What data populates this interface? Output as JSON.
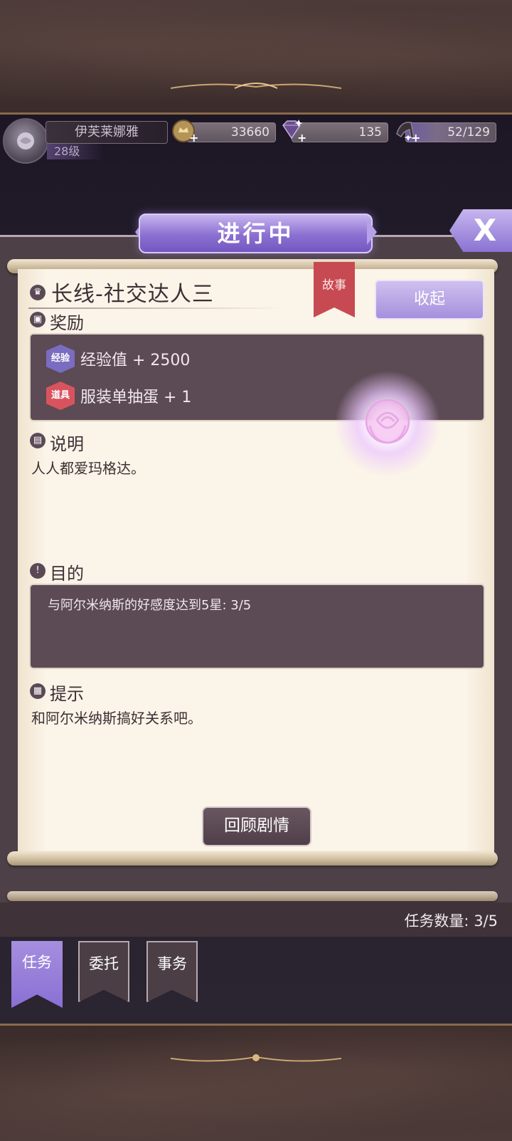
{
  "player": {
    "name": "伊芙莱娜雅",
    "level": "28级"
  },
  "resources": {
    "gold": "33660",
    "gems": "135",
    "stamina": "52/129"
  },
  "header": {
    "title": "进行中",
    "close_label": "X"
  },
  "quest": {
    "title": "长线-社交达人三",
    "tag": "故事",
    "collapse_label": "收起",
    "reward_label": "奖励",
    "rewards": [
      {
        "badge": "经验",
        "text": "经验值 + 2500",
        "color": "#7a6cc0"
      },
      {
        "badge": "道具",
        "text": "服装单抽蛋 + 1",
        "color": "#d9535f"
      }
    ],
    "description_label": "说明",
    "description": "人人都爱玛格达。",
    "objective_label": "目的",
    "objective": "与阿尔米纳斯的好感度达到5星: 3/5",
    "hint_label": "提示",
    "hint": "和阿尔米纳斯搞好关系吧。",
    "review_label": "回顾剧情"
  },
  "quest_count": "任务数量: 3/5",
  "tabs": [
    {
      "label": "任务",
      "active": true
    },
    {
      "label": "委托",
      "active": false
    },
    {
      "label": "事务",
      "active": false
    }
  ],
  "colors": {
    "accent": "#8b6fd0",
    "panel": "#4d4047",
    "paper": "#fbf4e8"
  }
}
